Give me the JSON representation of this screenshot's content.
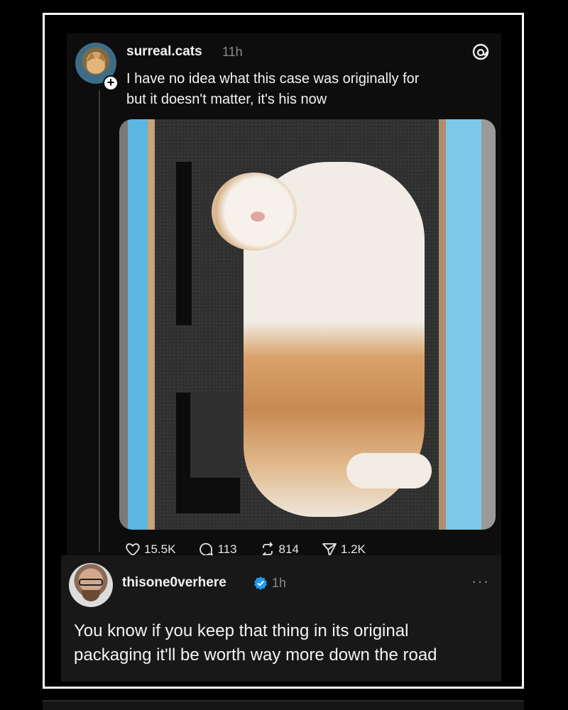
{
  "post": {
    "username": "surreal.cats",
    "time": "11h",
    "text_line1": "I have no idea what this case was originally for",
    "text_line2": "but it doesn't matter, it's his now",
    "follow_badge": "+",
    "stats": {
      "likes": "15.5K",
      "comments": "113",
      "reposts": "814",
      "shares": "1.2K"
    }
  },
  "reply": {
    "username": "thisone0verhere",
    "time": "1h",
    "more": "···",
    "text_line1": "You know if you keep that thing in its original",
    "text_line2": "packaging it'll be worth way more down the road"
  },
  "colors": {
    "background": "#000000",
    "post_background": "#0d0d0d",
    "reply_background": "#181818",
    "verified": "#1d9bf0",
    "muted_text": "#8a8a8a"
  },
  "icons": [
    "threads-icon",
    "heart-icon",
    "comment-icon",
    "repost-icon",
    "share-icon",
    "verified-icon",
    "more-icon"
  ]
}
